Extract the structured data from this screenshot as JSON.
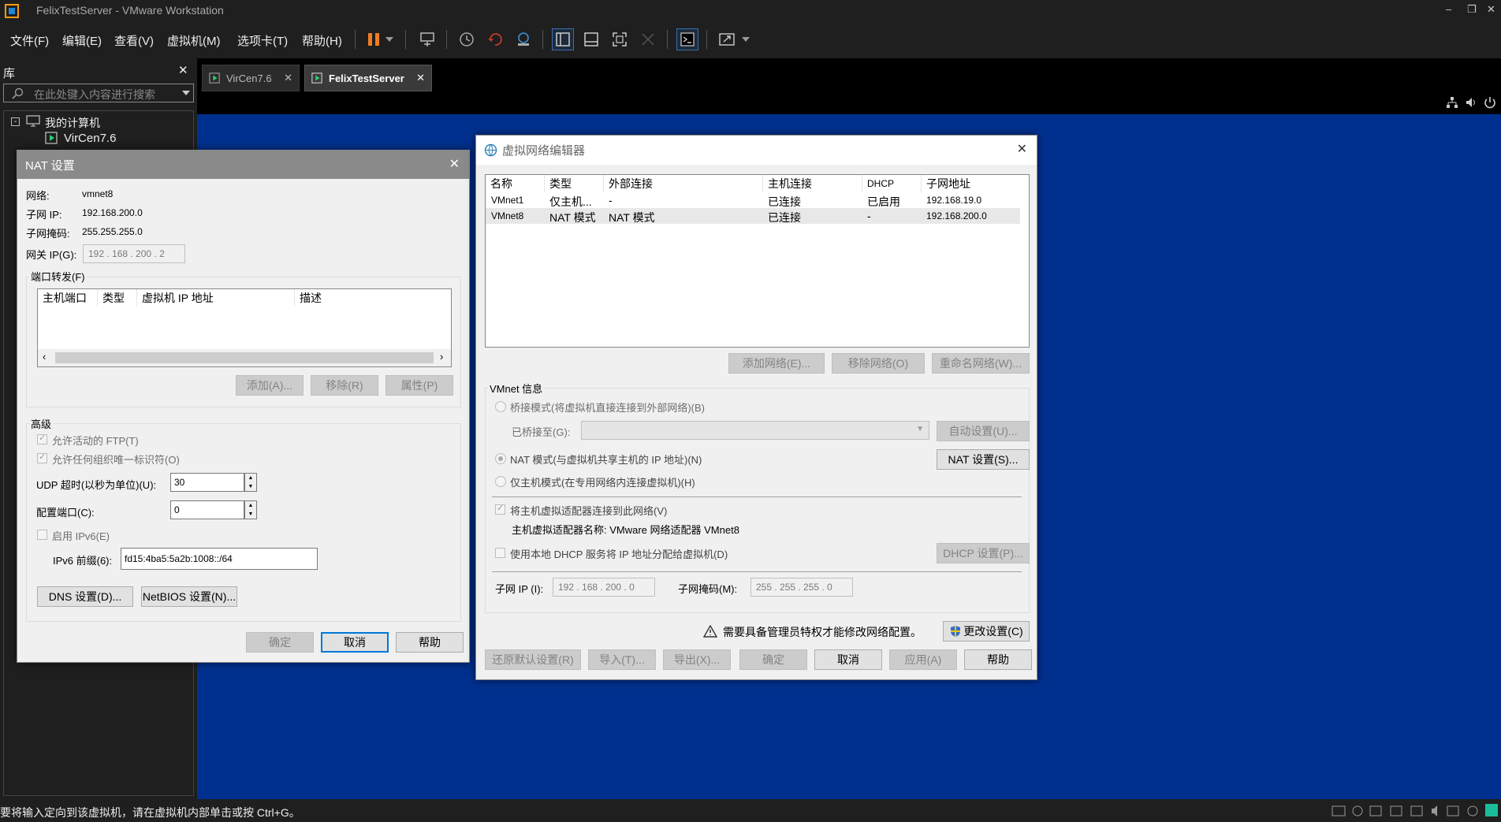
{
  "window": {
    "title": "FelixTestServer - VMware Workstation"
  },
  "menu": [
    "文件(F)",
    "编辑(E)",
    "查看(V)",
    "虚拟机(M)",
    "选项卡(T)",
    "帮助(H)"
  ],
  "library": {
    "header": "库",
    "search_placeholder": "在此处键入内容进行搜索",
    "tree": {
      "root": "我的计算机",
      "child": "VirCen7.6"
    }
  },
  "tabs": [
    {
      "label": "VirCen7.6",
      "active": false
    },
    {
      "label": "FelixTestServer",
      "active": true
    }
  ],
  "status": {
    "text": "要将输入定向到该虚拟机，请在虚拟机内部单击或按 Ctrl+G。"
  },
  "nat": {
    "title": "NAT 设置",
    "network_label": "网络:",
    "network_value": "vmnet8",
    "subnet_ip_label": "子网 IP:",
    "subnet_ip_value": "192.168.200.0",
    "subnet_mask_label": "子网掩码:",
    "subnet_mask_value": "255.255.255.0",
    "gateway_label": "网关 IP(G):",
    "gateway_value": "192 . 168 . 200 .  2",
    "port_forward_label": "端口转发(F)",
    "pf_columns": [
      "主机端口",
      "类型",
      "虚拟机 IP 地址",
      "描述"
    ],
    "pf_add": "添加(A)...",
    "pf_remove": "移除(R)",
    "pf_props": "属性(P)",
    "advanced_label": "高级",
    "allow_ftp": "允许活动的 FTP(T)",
    "allow_oui": "允许任何组织唯一标识符(O)",
    "udp_label": "UDP 超时(以秒为单位)(U):",
    "udp_value": "30",
    "config_port_label": "配置端口(C):",
    "config_port_value": "0",
    "ipv6_label": "启用 IPv6(E)",
    "ipv6_prefix_label": "IPv6 前缀(6):",
    "ipv6_prefix_value": "fd15:4ba5:5a2b:1008::/64",
    "dns_button": "DNS 设置(D)...",
    "netbios_button": "NetBIOS 设置(N)...",
    "ok": "确定",
    "cancel": "取消",
    "help": "帮助"
  },
  "vne": {
    "title": "虚拟网络编辑器",
    "columns": [
      "名称",
      "类型",
      "外部连接",
      "主机连接",
      "DHCP",
      "子网地址"
    ],
    "rows": [
      [
        "VMnet1",
        "仅主机...",
        "-",
        "已连接",
        "已启用",
        "192.168.19.0"
      ],
      [
        "VMnet8",
        "NAT 模式",
        "NAT 模式",
        "已连接",
        "-",
        "192.168.200.0"
      ]
    ],
    "add_network": "添加网络(E)...",
    "remove_network": "移除网络(O)",
    "rename_network": "重命名网络(W)...",
    "vmnet_info": "VMnet 信息",
    "bridged": "桥接模式(将虚拟机直接连接到外部网络)(B)",
    "bridged_to": "已桥接至(G):",
    "auto_settings": "自动设置(U)...",
    "nat_mode": "NAT 模式(与虚拟机共享主机的 IP 地址)(N)",
    "nat_settings": "NAT 设置(S)...",
    "host_only": "仅主机模式(在专用网络内连接虚拟机)(H)",
    "connect_adapter": "将主机虚拟适配器连接到此网络(V)",
    "adapter_name": "主机虚拟适配器名称: VMware 网络适配器 VMnet8",
    "use_dhcp": "使用本地 DHCP 服务将 IP 地址分配给虚拟机(D)",
    "dhcp_settings": "DHCP 设置(P)...",
    "subnet_ip_label": "子网 IP (I):",
    "subnet_ip_value": "192 . 168 . 200 .  0",
    "subnet_mask_label": "子网掩码(M):",
    "subnet_mask_value": "255 . 255 . 255 .  0",
    "admin_warning": "需要具备管理员特权才能修改网络配置。",
    "change_settings": "更改设置(C)",
    "restore_defaults": "还原默认设置(R)",
    "import": "导入(T)...",
    "export": "导出(X)...",
    "ok": "确定",
    "cancel": "取消",
    "apply": "应用(A)",
    "help": "帮助"
  }
}
